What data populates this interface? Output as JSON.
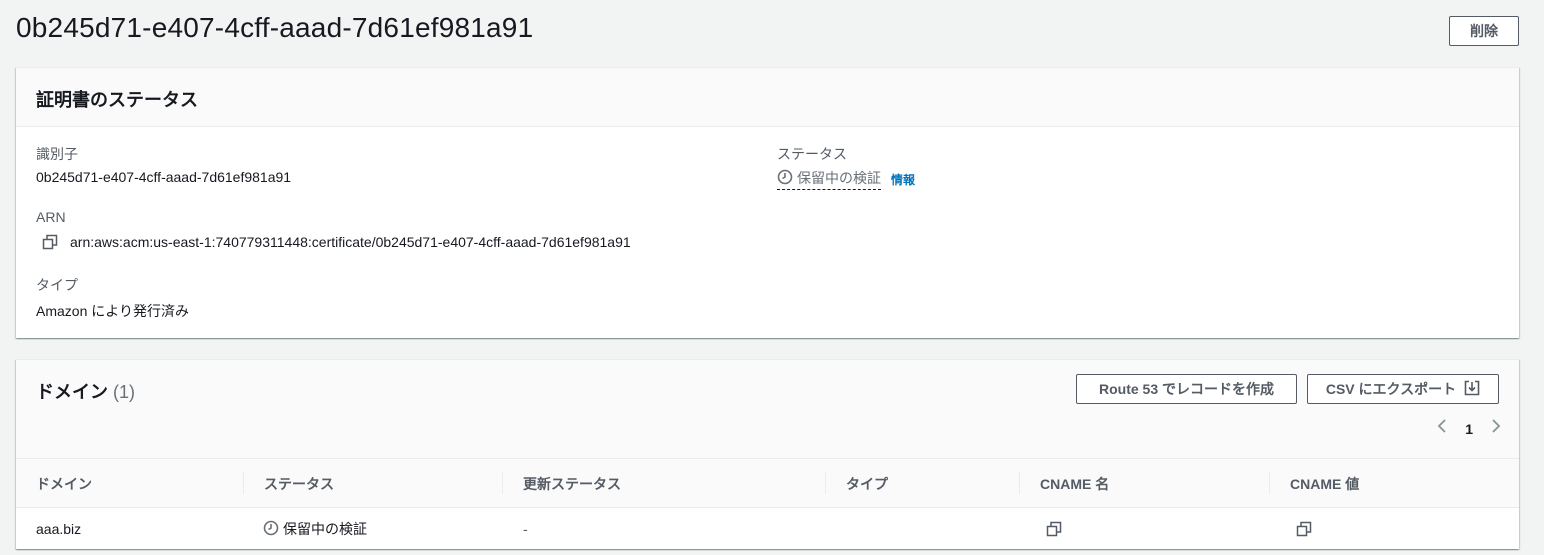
{
  "page": {
    "title": "0b245d71-e407-4cff-aaad-7d61ef981a91",
    "delete_label": "削除"
  },
  "status_section": {
    "title": "証明書のステータス",
    "identifier_label": "識別子",
    "identifier_value": "0b245d71-e407-4cff-aaad-7d61ef981a91",
    "arn_label": "ARN",
    "arn_value": "arn:aws:acm:us-east-1:740779311448:certificate/0b245d71-e407-4cff-aaad-7d61ef981a91",
    "type_label": "タイプ",
    "type_value": "Amazon により発行済み",
    "status_label": "ステータス",
    "status_value": "保留中の検証",
    "info_link": "情報"
  },
  "domains_section": {
    "title": "ドメイン",
    "count": "(1)",
    "route53_button": "Route 53 でレコードを作成",
    "csv_button": "CSV にエクスポート",
    "page_number": "1",
    "columns": [
      "ドメイン",
      "ステータス",
      "更新ステータス",
      "タイプ",
      "CNAME 名",
      "CNAME 値"
    ],
    "rows": [
      {
        "domain": "aaa.biz",
        "status": "保留中の検証",
        "renewal_status": "-",
        "type": ""
      }
    ]
  },
  "icons": {
    "clock": "clock-icon",
    "copy": "copy-icon",
    "download": "download-icon",
    "prev": "chevron-left-icon",
    "next": "chevron-right-icon"
  },
  "colors": {
    "background": "#f2f3f3",
    "link": "#0073bb",
    "muted": "#687078",
    "border": "#545b64"
  }
}
